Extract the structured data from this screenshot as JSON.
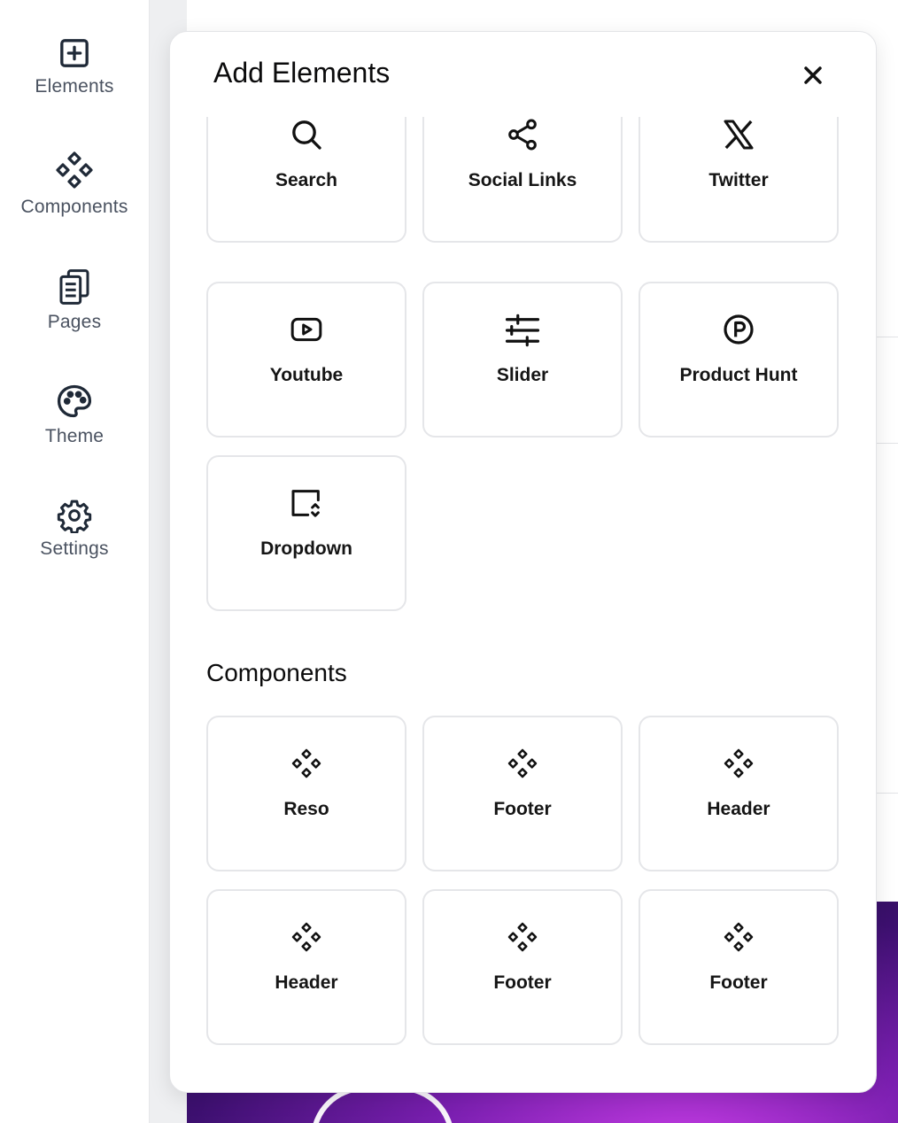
{
  "sidebar": {
    "items": [
      {
        "label": "Elements",
        "icon": "plus-square-icon"
      },
      {
        "label": "Components",
        "icon": "components-diamond-icon"
      },
      {
        "label": "Pages",
        "icon": "pages-icon"
      },
      {
        "label": "Theme",
        "icon": "palette-icon"
      },
      {
        "label": "Settings",
        "icon": "gear-icon"
      }
    ]
  },
  "panel": {
    "title": "Add Elements",
    "close_icon": "close-icon",
    "elements": [
      {
        "label": "Search",
        "icon": "search-icon"
      },
      {
        "label": "Social Links",
        "icon": "share-icon"
      },
      {
        "label": "Twitter",
        "icon": "x-logo-icon"
      },
      {
        "label": "Youtube",
        "icon": "youtube-icon"
      },
      {
        "label": "Slider",
        "icon": "sliders-icon"
      },
      {
        "label": "Product Hunt",
        "icon": "product-hunt-icon"
      },
      {
        "label": "Dropdown",
        "icon": "dropdown-icon"
      }
    ],
    "components_heading": "Components",
    "components": [
      {
        "label": "Reso",
        "icon": "component-icon"
      },
      {
        "label": "Footer",
        "icon": "component-icon"
      },
      {
        "label": "Header",
        "icon": "component-icon"
      },
      {
        "label": "Header",
        "icon": "component-icon"
      },
      {
        "label": "Footer",
        "icon": "component-icon"
      },
      {
        "label": "Footer",
        "icon": "component-icon"
      }
    ]
  },
  "colors": {
    "sidebar_text": "#4a5260",
    "card_border": "#e5e6e9",
    "banner_purple": "#7a1fb0"
  }
}
